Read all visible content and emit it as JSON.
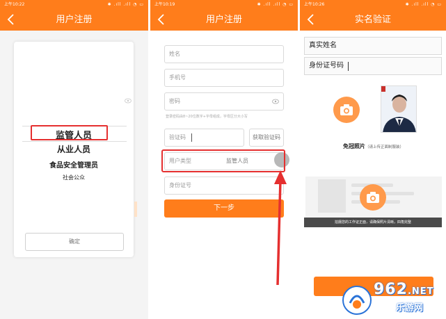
{
  "panel1": {
    "status_time": "上午10:22",
    "status_right": "✱ .ıll .ıll ◔ ▭",
    "title": "用户注册",
    "picker_options": [
      "监管人员",
      "从业人员",
      "食品安全管理员",
      "社会公众"
    ],
    "confirm_label": "确定"
  },
  "panel2": {
    "status_time": "上午10:19",
    "status_right": "✱ .ıll .ıll ◔ ▭",
    "title": "用户注册",
    "name_placeholder": "姓名",
    "phone_placeholder": "手机号",
    "password_placeholder": "密码",
    "password_hint": "登录密码由8~20位数字+字母组成，字母区分大小写",
    "code_placeholder": "验证码",
    "get_code_label": "获取验证码",
    "user_type_label": "用户类型",
    "user_type_value": "监管人员",
    "id_placeholder": "身份证号",
    "next_label": "下一步"
  },
  "panel3": {
    "status_time": "上午10:26",
    "status_right": "✱ .ıll .ıll ◔ ▭",
    "title": "实名验证",
    "real_name_label": "真实姓名",
    "id_number_label": "身份证号码",
    "photo_label": "免冠照片",
    "photo_sublabel": "（请上传正面制服装）",
    "work_card_tip": "拍摄您的工作证正面，请确保照片清晰，四角完整"
  },
  "watermark": {
    "number": "962",
    "suffix": ".NET",
    "name": "乐游网"
  },
  "colors": {
    "brand_orange": "#ff7d1b",
    "highlight_red": "#e52f2f"
  }
}
